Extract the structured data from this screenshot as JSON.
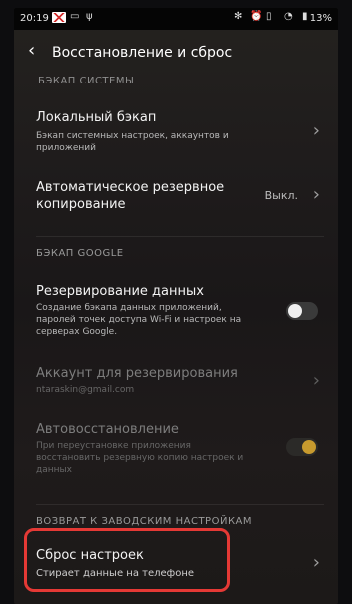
{
  "status": {
    "time": "20:19",
    "battery": "13%"
  },
  "header": {
    "title": "Восстановление и сброс"
  },
  "sections": {
    "system_backup_cut": "БЭКАП СИСТЕМЫ",
    "google_backup": "БЭКАП GOOGLE",
    "factory": "ВОЗВРАТ К ЗАВОДСКИМ НАСТРОЙКАМ"
  },
  "items": {
    "local_backup": {
      "title": "Локальный бэкап",
      "subtitle_1": "Бэкап системных настроек, аккаунтов и",
      "subtitle_2": "приложений"
    },
    "auto_backup": {
      "title_1": "Автоматическое резервное",
      "title_2": "копирование",
      "value": "Выкл."
    },
    "data_backup": {
      "title": "Резервирование данных",
      "subtitle_1": "Создание бэкапа данных приложений,",
      "subtitle_2": "паролей точек доступа Wi-Fi и настроек на",
      "subtitle_3": "серверах Google."
    },
    "backup_account": {
      "title": "Аккаунт для резервирования",
      "subtitle": "ntaraskin@gmail.com"
    },
    "auto_restore": {
      "title": "Автовосстановление",
      "subtitle_1": "При переустановке приложения",
      "subtitle_2": "восстановить резервную копию настроек и",
      "subtitle_3": "данных"
    },
    "reset": {
      "title": "Сброс настроек",
      "subtitle": "Стирает данные на телефоне"
    }
  },
  "icons": {
    "back": "chevron-left-icon",
    "chevron": "chevron-right-icon"
  },
  "colors": {
    "highlight": "#e53935",
    "toggle_on_knob": "#c79a2e"
  }
}
